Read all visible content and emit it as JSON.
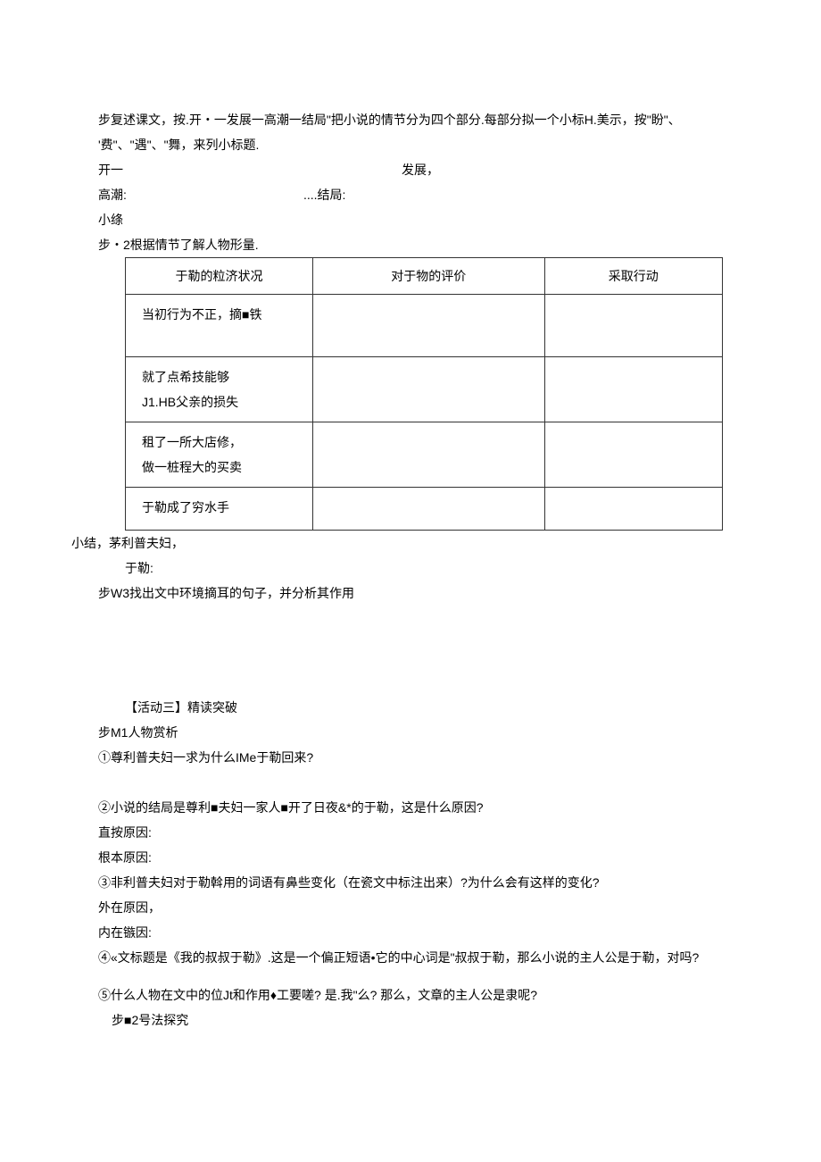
{
  "p1": "步复述课文，按.开・一发展一高潮一结局\"把小说的情节分为四个部分.每部分拟一个小标H.美示，按\"盼\"、  '费\"、\"遇\"、\"舞，来列小标题.",
  "line_open_dev": {
    "left": "开一",
    "right": "发展，"
  },
  "line_climax_end": {
    "left": "高潮:",
    "right": "....结局:"
  },
  "line_summary": "小绦",
  "step2_heading": "步・2根据情节了解人物形量.",
  "table": {
    "headers": [
      "于勒的粒济状况",
      "对于物的评价",
      "采取行动"
    ],
    "rows": [
      [
        "当初行为不正，摘■铁",
        "",
        ""
      ],
      [
        "就了点希技能够\nJ1.HB父亲的损失",
        "",
        ""
      ],
      [
        "租了一所大店修，\n做一桩程大的买卖",
        "",
        ""
      ],
      [
        "于勒成了穷水手",
        "",
        ""
      ]
    ]
  },
  "summary_couple": "小结，茅利普夫妇，",
  "yule_label": "于勒:",
  "step_w3": "步W3找出文中环境摘耳的句子，并分析其作用",
  "activity3": "【活动三】精读突破",
  "step_m1": "步M1人物赏析",
  "q1": "①尊利普夫妇一求为什么IMe于勒回来?",
  "q2": "②小说的结局是尊利■夫妇一家人■开了日夜&*的于勒，这是什么原因?",
  "direct_reason": "直按原因:",
  "root_reason": "根本原因:",
  "q3": "③非利普夫妇对于勒斡用的词语有鼻些变化（在瓷文中标注出来）?为什么会有这样的变化?",
  "external_reason": "外在原因，",
  "internal_reason": "内在镞因:",
  "q4": "④«文标题是《我的叔叔于勒》.这是一个偏正短语•它的中心词是\"叔叔于勒，那么小说的主人公是于勒，对吗?",
  "q5": "⑤什么人物在文中的位Jt和作用♦工要嗟? 是.我\"么? 那么，文章的主人公是隶呢?",
  "step_b2": "步■2号法探究"
}
